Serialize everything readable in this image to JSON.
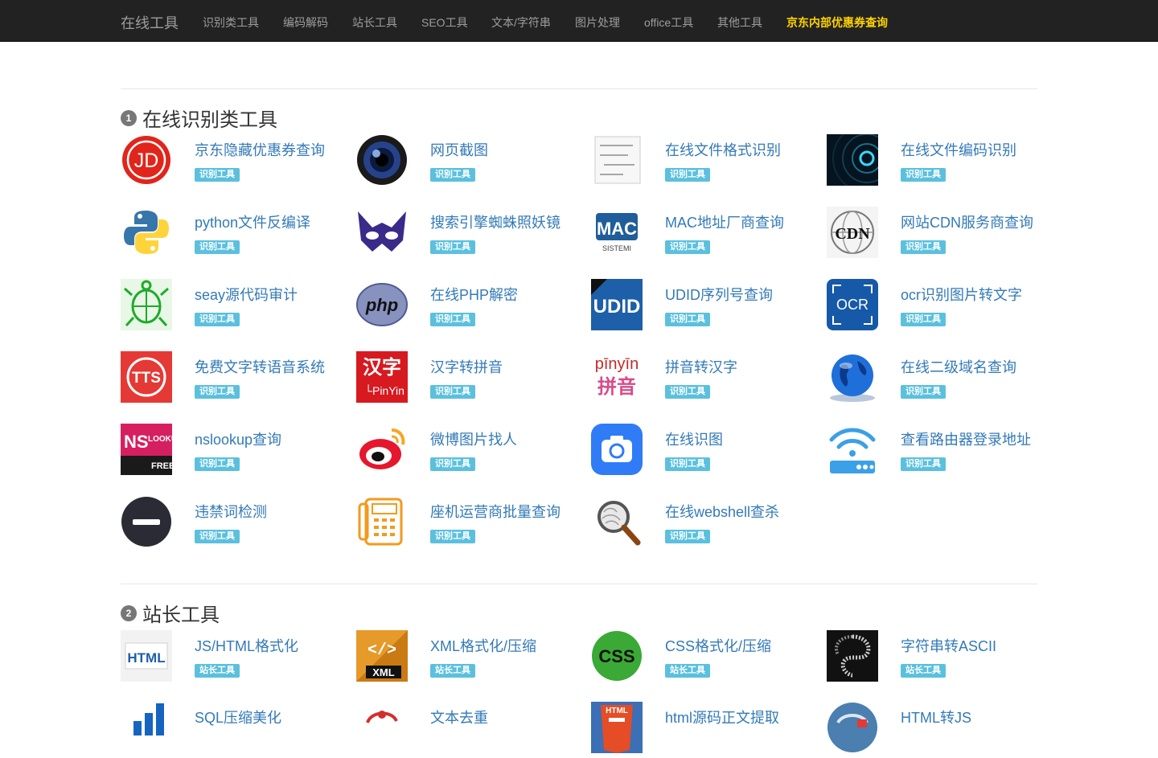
{
  "nav": {
    "brand": "在线工具",
    "items": [
      "识别类工具",
      "编码解码",
      "站长工具",
      "SEO工具",
      "文本/字符串",
      "图片处理",
      "office工具",
      "其他工具"
    ],
    "highlight": "京东内部优惠券查询"
  },
  "colors": {
    "navbar": "#222222",
    "link": "#337ab7",
    "tag": "#5bc0de",
    "highlight": "#ffd200"
  },
  "sections": [
    {
      "number": "1",
      "title": "在线识别类工具",
      "tag": "识别工具",
      "tools": [
        {
          "name": "京东隐藏优惠券查询",
          "icon": "jd-logo-icon"
        },
        {
          "name": "网页截图",
          "icon": "camera-lens-icon"
        },
        {
          "name": "在线文件格式识别",
          "icon": "text-document-icon"
        },
        {
          "name": "在线文件编码识别",
          "icon": "sonar-ring-icon"
        },
        {
          "name": "python文件反编译",
          "icon": "python-logo-icon"
        },
        {
          "name": "搜索引擎蜘蛛照妖镜",
          "icon": "mask-icon"
        },
        {
          "name": "MAC地址厂商查询",
          "icon": "mac-logo-icon"
        },
        {
          "name": "网站CDN服务商查询",
          "icon": "cdn-globe-icon"
        },
        {
          "name": "seay源代码审计",
          "icon": "turtle-icon"
        },
        {
          "name": "在线PHP解密",
          "icon": "php-logo-icon"
        },
        {
          "name": "UDID序列号查询",
          "icon": "udid-logo-icon"
        },
        {
          "name": "ocr识别图片转文字",
          "icon": "ocr-icon"
        },
        {
          "name": "免费文字转语音系统",
          "icon": "tts-icon"
        },
        {
          "name": "汉字转拼音",
          "icon": "hanzi-pinyin-icon"
        },
        {
          "name": "拼音转汉字",
          "icon": "pinyin-hanzi-icon"
        },
        {
          "name": "在线二级域名查询",
          "icon": "globe-icon"
        },
        {
          "name": "nslookup查询",
          "icon": "nslookup-icon"
        },
        {
          "name": "微博图片找人",
          "icon": "weibo-logo-icon"
        },
        {
          "name": "在线识图",
          "icon": "camera-app-icon"
        },
        {
          "name": "查看路由器登录地址",
          "icon": "wifi-router-icon"
        },
        {
          "name": "违禁词检测",
          "icon": "no-entry-icon"
        },
        {
          "name": "座机运营商批量查询",
          "icon": "phone-icon"
        },
        {
          "name": "在线webshell查杀",
          "icon": "magnifier-icon"
        }
      ]
    },
    {
      "number": "2",
      "title": "站长工具",
      "tag": "站长工具",
      "tools": [
        {
          "name": "JS/HTML格式化",
          "icon": "html-badge-icon"
        },
        {
          "name": "XML格式化/压缩",
          "icon": "xml-badge-icon"
        },
        {
          "name": "CSS格式化/压缩",
          "icon": "css-badge-icon"
        },
        {
          "name": "字符串转ASCII",
          "icon": "ascii-art-icon"
        },
        {
          "name": "SQL压缩美化",
          "icon": "sql-chart-icon"
        },
        {
          "name": "文本去重",
          "icon": "dedupe-icon"
        },
        {
          "name": "html源码正文提取",
          "icon": "html5-icon"
        },
        {
          "name": "HTML转JS",
          "icon": "html-js-icon"
        }
      ]
    }
  ]
}
